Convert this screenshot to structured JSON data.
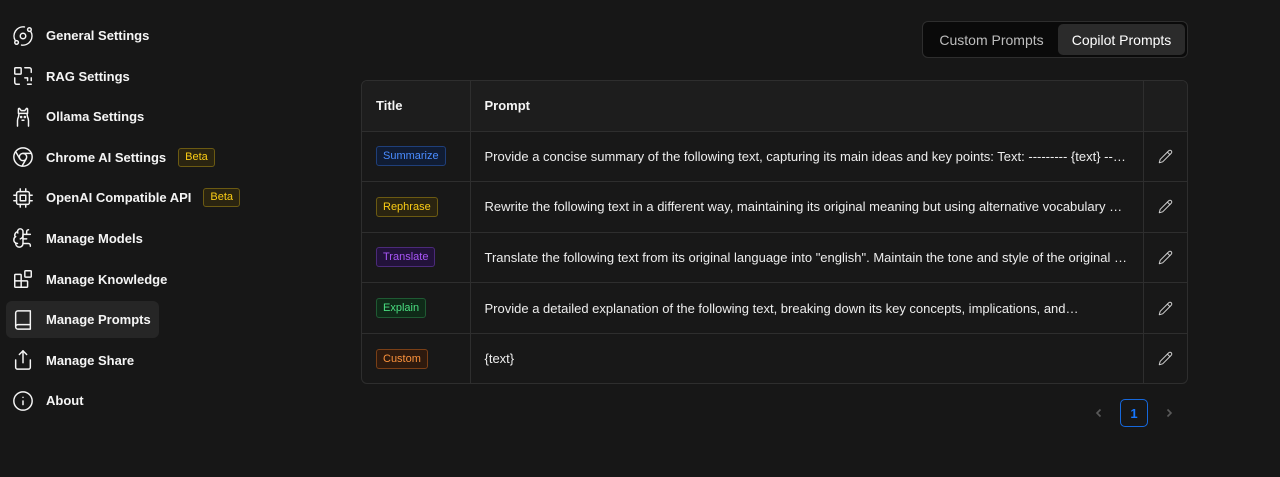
{
  "sidebar": {
    "items": [
      {
        "label": "General Settings",
        "icon": "orbit-icon"
      },
      {
        "label": "RAG Settings",
        "icon": "scan-icon"
      },
      {
        "label": "Ollama Settings",
        "icon": "llama-icon"
      },
      {
        "label": "Chrome AI Settings",
        "icon": "chrome-icon",
        "badge": "Beta"
      },
      {
        "label": "OpenAI Compatible API",
        "icon": "cpu-icon",
        "badge": "Beta"
      },
      {
        "label": "Manage Models",
        "icon": "brain-icon"
      },
      {
        "label": "Manage Knowledge",
        "icon": "blocks-icon"
      },
      {
        "label": "Manage Prompts",
        "icon": "book-icon",
        "active": true
      },
      {
        "label": "Manage Share",
        "icon": "share-icon"
      },
      {
        "label": "About",
        "icon": "info-icon"
      }
    ]
  },
  "tabs": {
    "custom": "Custom Prompts",
    "copilot": "Copilot Prompts",
    "selected": "Copilot Prompts"
  },
  "table": {
    "headers": {
      "title": "Title",
      "prompt": "Prompt",
      "action": ""
    },
    "rows": [
      {
        "title": "Summarize",
        "color": "blue",
        "prompt": "Provide a concise summary of the following text, capturing its main ideas and key points: Text: --------- {text} ---------"
      },
      {
        "title": "Rephrase",
        "color": "gold",
        "prompt": "Rewrite the following text in a different way, maintaining its original meaning but using alternative vocabulary and sentence structures"
      },
      {
        "title": "Translate",
        "color": "purple",
        "prompt": "Translate the following text from its original language into \"english\". Maintain the tone and style of the original text"
      },
      {
        "title": "Explain",
        "color": "green",
        "prompt": "Provide a detailed explanation of the following text, breaking down its key concepts, implications, and…"
      },
      {
        "title": "Custom",
        "color": "orange",
        "prompt": "{text}"
      }
    ]
  },
  "pagination": {
    "current": "1"
  },
  "colors": {
    "background": "#171717",
    "accent": "#1677ff",
    "beta": "#facc15"
  }
}
